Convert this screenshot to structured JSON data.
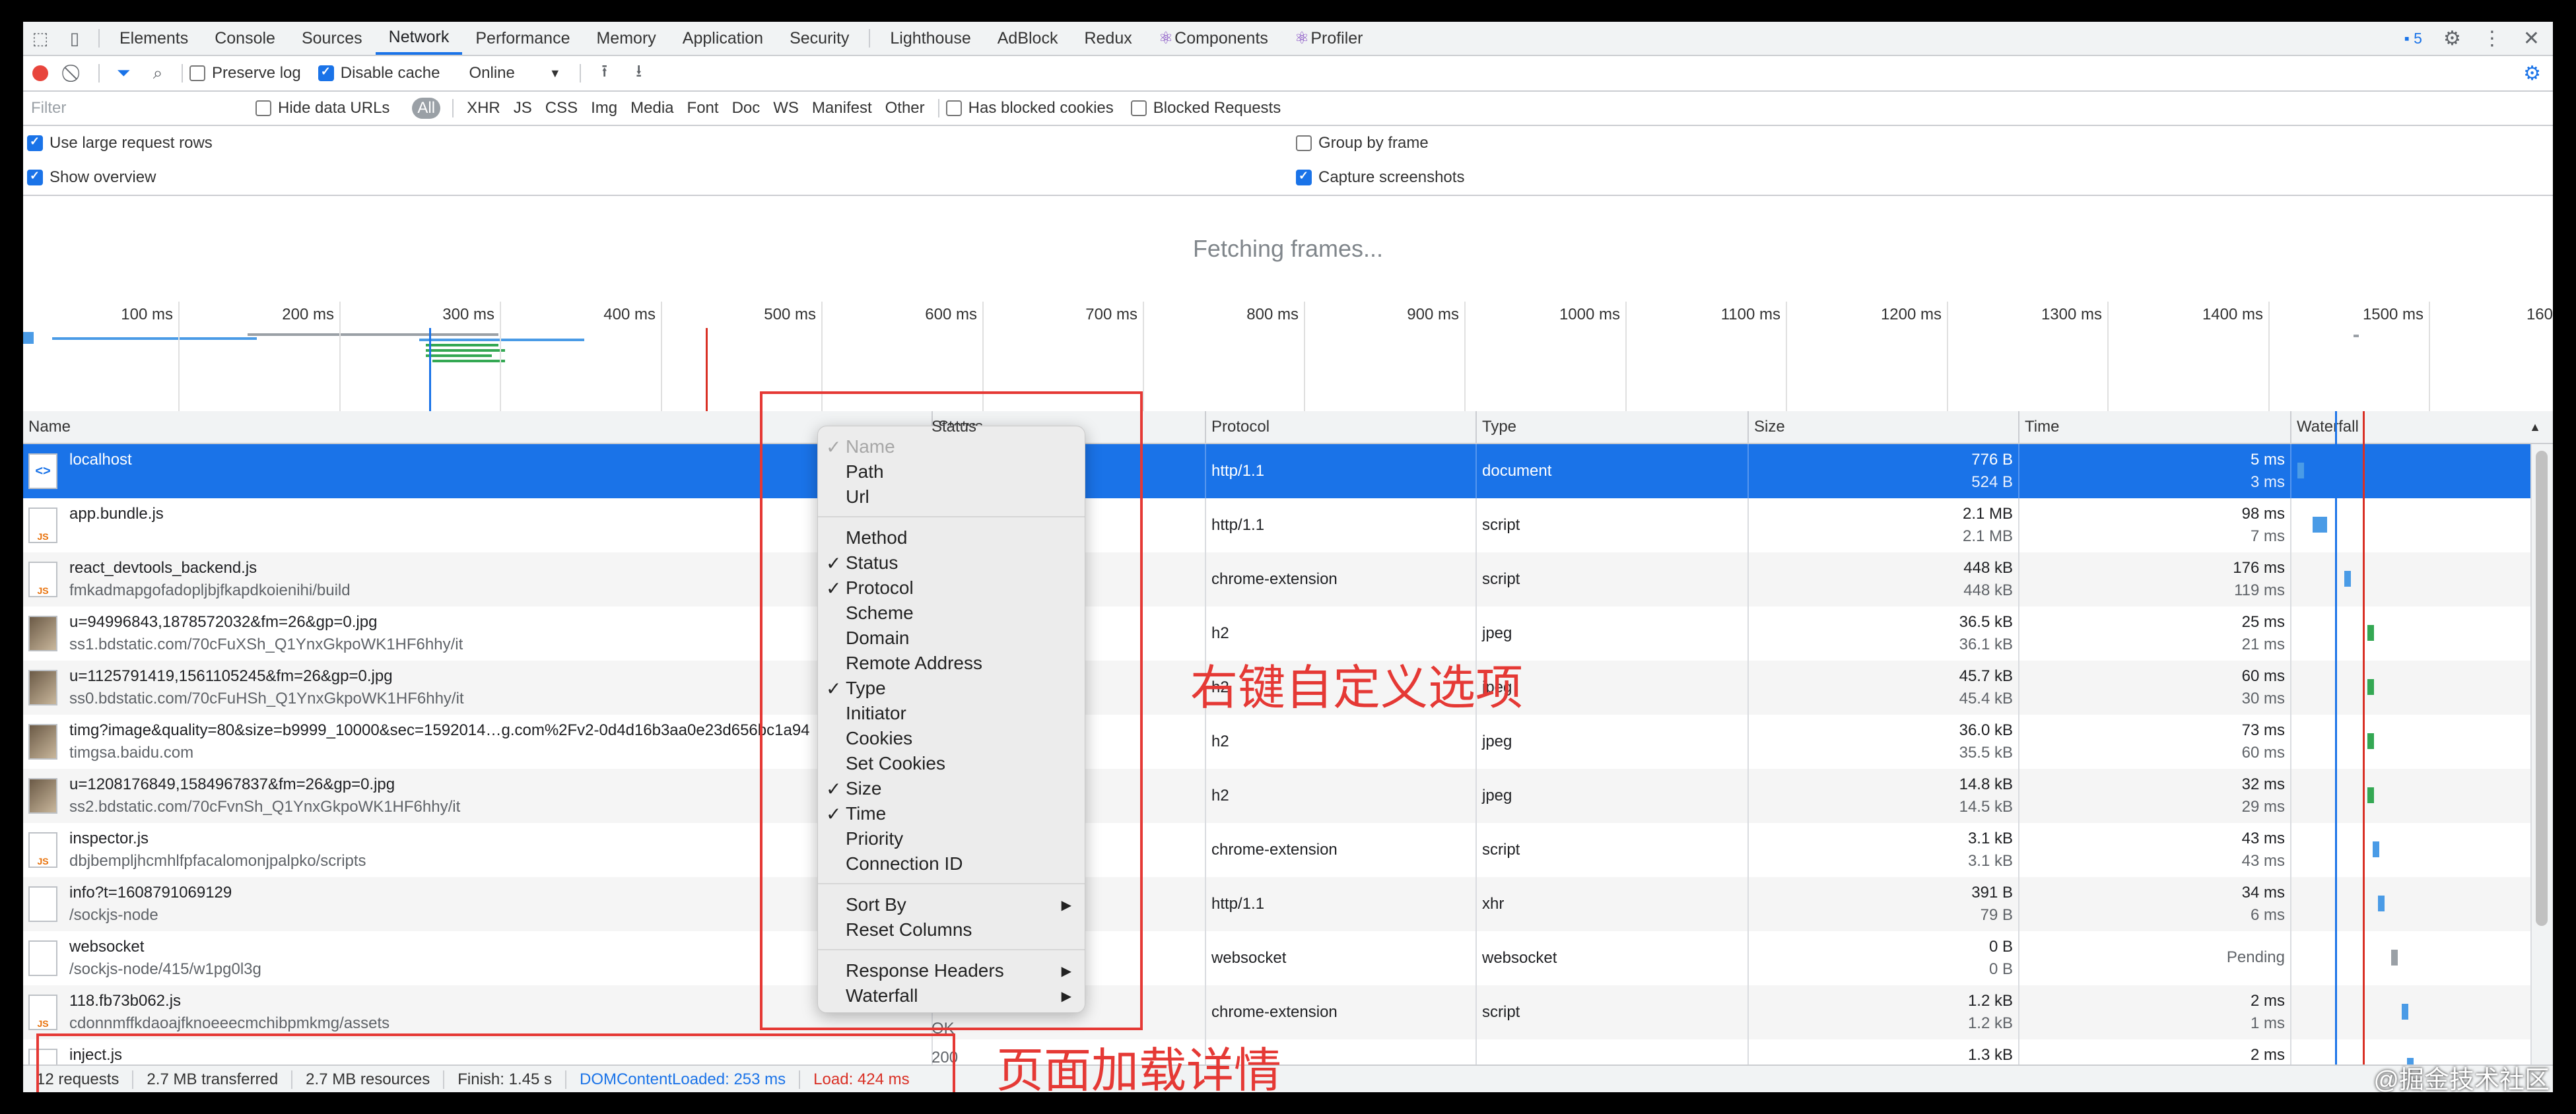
{
  "tabs": [
    "Elements",
    "Console",
    "Sources",
    "Network",
    "Performance",
    "Memory",
    "Application",
    "Security",
    "Lighthouse",
    "AdBlock",
    "Redux",
    "Components",
    "Profiler"
  ],
  "active_tab": "Network",
  "issues_count": "5",
  "toolbar": {
    "preserve_log": "Preserve log",
    "disable_cache": "Disable cache",
    "throttle": "Online"
  },
  "filter": {
    "placeholder": "Filter",
    "hide_data_urls": "Hide data URLs",
    "types": [
      "All",
      "XHR",
      "JS",
      "CSS",
      "Img",
      "Media",
      "Font",
      "Doc",
      "WS",
      "Manifest",
      "Other"
    ],
    "has_blocked_cookies": "Has blocked cookies",
    "blocked_requests": "Blocked Requests"
  },
  "settings": {
    "large_rows": "Use large request rows",
    "show_overview": "Show overview",
    "group_by_frame": "Group by frame",
    "capture_screenshots": "Capture screenshots"
  },
  "fetching": "Fetching frames...",
  "overview_ticks": [
    "100 ms",
    "200 ms",
    "300 ms",
    "400 ms",
    "500 ms",
    "600 ms",
    "700 ms",
    "800 ms",
    "900 ms",
    "1000 ms",
    "1100 ms",
    "1200 ms",
    "1300 ms",
    "1400 ms",
    "1500 ms",
    "160"
  ],
  "columns": [
    "Name",
    "Status",
    "Protocol",
    "Type",
    "Size",
    "Time",
    "Waterfall"
  ],
  "rows": [
    {
      "name": "localhost",
      "sub": "",
      "protocol": "http/1.1",
      "type": "document",
      "size1": "776 B",
      "size2": "524 B",
      "time1": "5 ms",
      "time2": "3 ms",
      "icon": "doc",
      "wf_start": 0.002,
      "wf_color": "#4a9be6"
    },
    {
      "name": "app.bundle.js",
      "sub": "",
      "protocol": "http/1.1",
      "type": "script",
      "size1": "2.1 MB",
      "size2": "2.1 MB",
      "time1": "98 ms",
      "time2": "7 ms",
      "icon": "js",
      "wf_start": 0.06,
      "wf_color": "#4a9be6"
    },
    {
      "name": "react_devtools_backend.js",
      "sub": "fmkadmapgofadopljbjfkapdkoienihi/build",
      "protocol": "chrome-extension",
      "type": "script",
      "size1": "448 kB",
      "size2": "448 kB",
      "time1": "176 ms",
      "time2": "119 ms",
      "icon": "js",
      "wf_start": 0.18,
      "wf_color": "#4a9be6"
    },
    {
      "name": "u=94996843,1878572032&fm=26&gp=0.jpg",
      "sub": "ss1.bdstatic.com/70cFuXSh_Q1YnxGkpoWK1HF6hhy/it",
      "protocol": "h2",
      "type": "jpeg",
      "size1": "36.5 kB",
      "size2": "36.1 kB",
      "time1": "25 ms",
      "time2": "21 ms",
      "icon": "img",
      "wf_start": 0.27,
      "wf_color": "#34a853"
    },
    {
      "name": "u=1125791419,1561105245&fm=26&gp=0.jpg",
      "sub": "ss0.bdstatic.com/70cFuHSh_Q1YnxGkpoWK1HF6hhy/it",
      "protocol": "h2",
      "type": "jpeg",
      "size1": "45.7 kB",
      "size2": "45.4 kB",
      "time1": "60 ms",
      "time2": "30 ms",
      "icon": "img",
      "wf_start": 0.27,
      "wf_color": "#34a853"
    },
    {
      "name": "timg?image&quality=80&size=b9999_10000&sec=1592014…g.com%2Fv2-0d4d16b3aa0e23d656bc1a94",
      "sub": "timgsa.baidu.com",
      "protocol": "h2",
      "type": "jpeg",
      "size1": "36.0 kB",
      "size2": "35.5 kB",
      "time1": "73 ms",
      "time2": "60 ms",
      "icon": "img",
      "wf_start": 0.27,
      "wf_color": "#34a853"
    },
    {
      "name": "u=1208176849,1584967837&fm=26&gp=0.jpg",
      "sub": "ss2.bdstatic.com/70cFvnSh_Q1YnxGkpoWK1HF6hhy/it",
      "protocol": "h2",
      "type": "jpeg",
      "size1": "14.8 kB",
      "size2": "14.5 kB",
      "time1": "32 ms",
      "time2": "29 ms",
      "icon": "img",
      "wf_start": 0.27,
      "wf_color": "#34a853"
    },
    {
      "name": "inspector.js",
      "sub": "dbjbempljhcmhlfpfacalomonjpalpko/scripts",
      "protocol": "chrome-extension",
      "type": "script",
      "size1": "3.1 kB",
      "size2": "3.1 kB",
      "time1": "43 ms",
      "time2": "43 ms",
      "icon": "js",
      "wf_start": 0.29,
      "wf_color": "#4a9be6"
    },
    {
      "name": "info?t=1608791069129",
      "sub": "/sockjs-node",
      "protocol": "http/1.1",
      "type": "xhr",
      "size1": "391 B",
      "size2": "79 B",
      "time1": "34 ms",
      "time2": "6 ms",
      "icon": "blank",
      "wf_start": 0.31,
      "wf_color": "#4a9be6"
    },
    {
      "name": "websocket",
      "sub": "/sockjs-node/415/w1pg0l3g",
      "protocol": "websocket",
      "type": "websocket",
      "size1": "0 B",
      "size2": "0 B",
      "time1": "Pending",
      "time2": "",
      "icon": "blank",
      "wf_start": 0.36,
      "wf_color": "#9aa0a6"
    },
    {
      "name": "118.fb73b062.js",
      "sub": "cdonnmffkdaoajfknoeeecmchibpmkmg/assets",
      "protocol": "chrome-extension",
      "type": "script",
      "size1": "1.2 kB",
      "size2": "1.2 kB",
      "time1": "2 ms",
      "time2": "1 ms",
      "icon": "js",
      "wf_start": 0.4,
      "wf_color": "#4a9be6"
    },
    {
      "name": "inject.js",
      "sub": "",
      "protocol": "",
      "type": "",
      "size1": "1.3 kB",
      "size2": "",
      "time1": "2 ms",
      "time2": "",
      "icon": "js",
      "wf_start": 0.42,
      "wf_color": "#4a9be6"
    }
  ],
  "statusbar": {
    "requests": "12 requests",
    "transferred": "2.7 MB transferred",
    "resources": "2.7 MB resources",
    "finish": "Finish: 1.45 s",
    "dcl": "DOMContentLoaded: 253 ms",
    "load": "Load: 424 ms"
  },
  "menu": [
    {
      "label": "Name",
      "checked": true,
      "disabled": true
    },
    {
      "label": "Path",
      "checked": false
    },
    {
      "label": "Url",
      "checked": false
    },
    {
      "sep": true
    },
    {
      "label": "Method",
      "checked": false
    },
    {
      "label": "Status",
      "checked": true
    },
    {
      "label": "Protocol",
      "checked": true
    },
    {
      "label": "Scheme",
      "checked": false
    },
    {
      "label": "Domain",
      "checked": false
    },
    {
      "label": "Remote Address",
      "checked": false
    },
    {
      "label": "Type",
      "checked": true
    },
    {
      "label": "Initiator",
      "checked": false
    },
    {
      "label": "Cookies",
      "checked": false
    },
    {
      "label": "Set Cookies",
      "checked": false
    },
    {
      "label": "Size",
      "checked": true
    },
    {
      "label": "Time",
      "checked": true
    },
    {
      "label": "Priority",
      "checked": false
    },
    {
      "label": "Connection ID",
      "checked": false
    },
    {
      "sep": true
    },
    {
      "label": "Sort By",
      "submenu": true
    },
    {
      "label": "Reset Columns"
    },
    {
      "sep": true
    },
    {
      "label": "Response Headers",
      "submenu": true
    },
    {
      "label": "Waterfall",
      "submenu": true
    }
  ],
  "annotations": {
    "custom_options": "右键自定义选项",
    "load_details": "页面加载详情",
    "watermark": "@掘金技术社区"
  },
  "partial_visible": {
    "status_ok": "OK",
    "status_200": "200",
    "status_header": "Status"
  },
  "colors": {
    "accent": "#1a73e8",
    "annotation": "#e53935",
    "dcl_line": "#1a73e8",
    "load_line": "#d93025"
  }
}
